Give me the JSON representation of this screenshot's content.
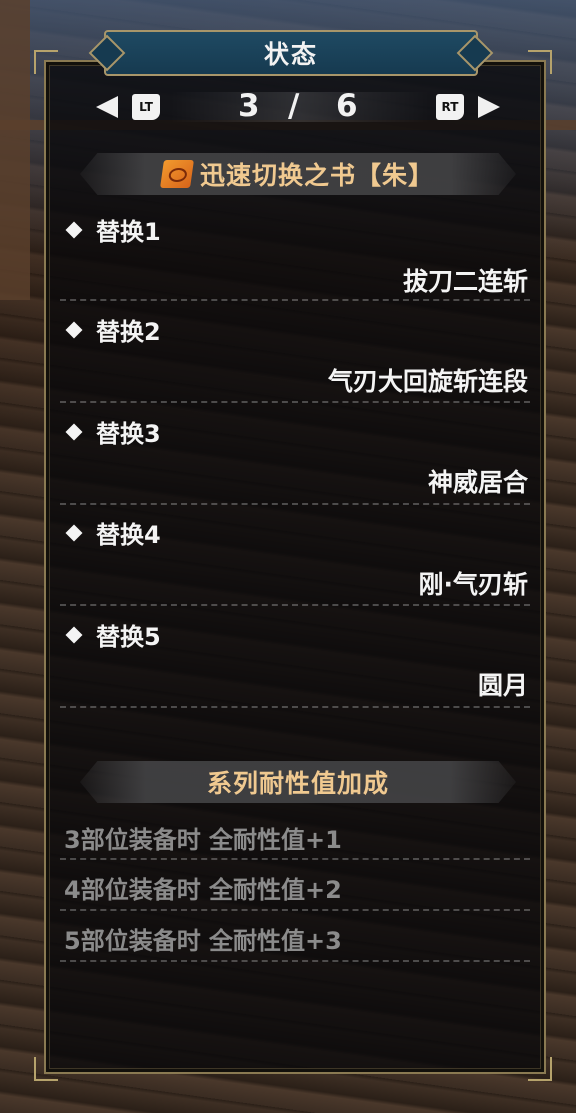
{
  "window": {
    "title": "状态"
  },
  "pager": {
    "left_button": "LT",
    "right_button": "RT",
    "current": "3",
    "separator": "/",
    "total": "6"
  },
  "book": {
    "icon": "scroll-book-icon",
    "title": "迅速切换之书【朱】",
    "entries": [
      {
        "label": "替换1",
        "value": "拔刀二连斩"
      },
      {
        "label": "替换2",
        "value": "气刃大回旋斩连段"
      },
      {
        "label": "替换3",
        "value": "神威居合"
      },
      {
        "label": "替换4",
        "value": "刚·气刃斩"
      },
      {
        "label": "替换5",
        "value": "圆月"
      }
    ]
  },
  "set_bonus": {
    "title": "系列耐性值加成",
    "lines": [
      "3部位装备时 全耐性值+1",
      "4部位装备时 全耐性值+2",
      "5部位装备时 全耐性值+3"
    ]
  },
  "colors": {
    "title_bar": "#1f4a63",
    "frame": "#a8966a",
    "section_title": "#f0c990",
    "bonus_text": "#8b8b8b",
    "icon_orange": "#f29a2e"
  }
}
